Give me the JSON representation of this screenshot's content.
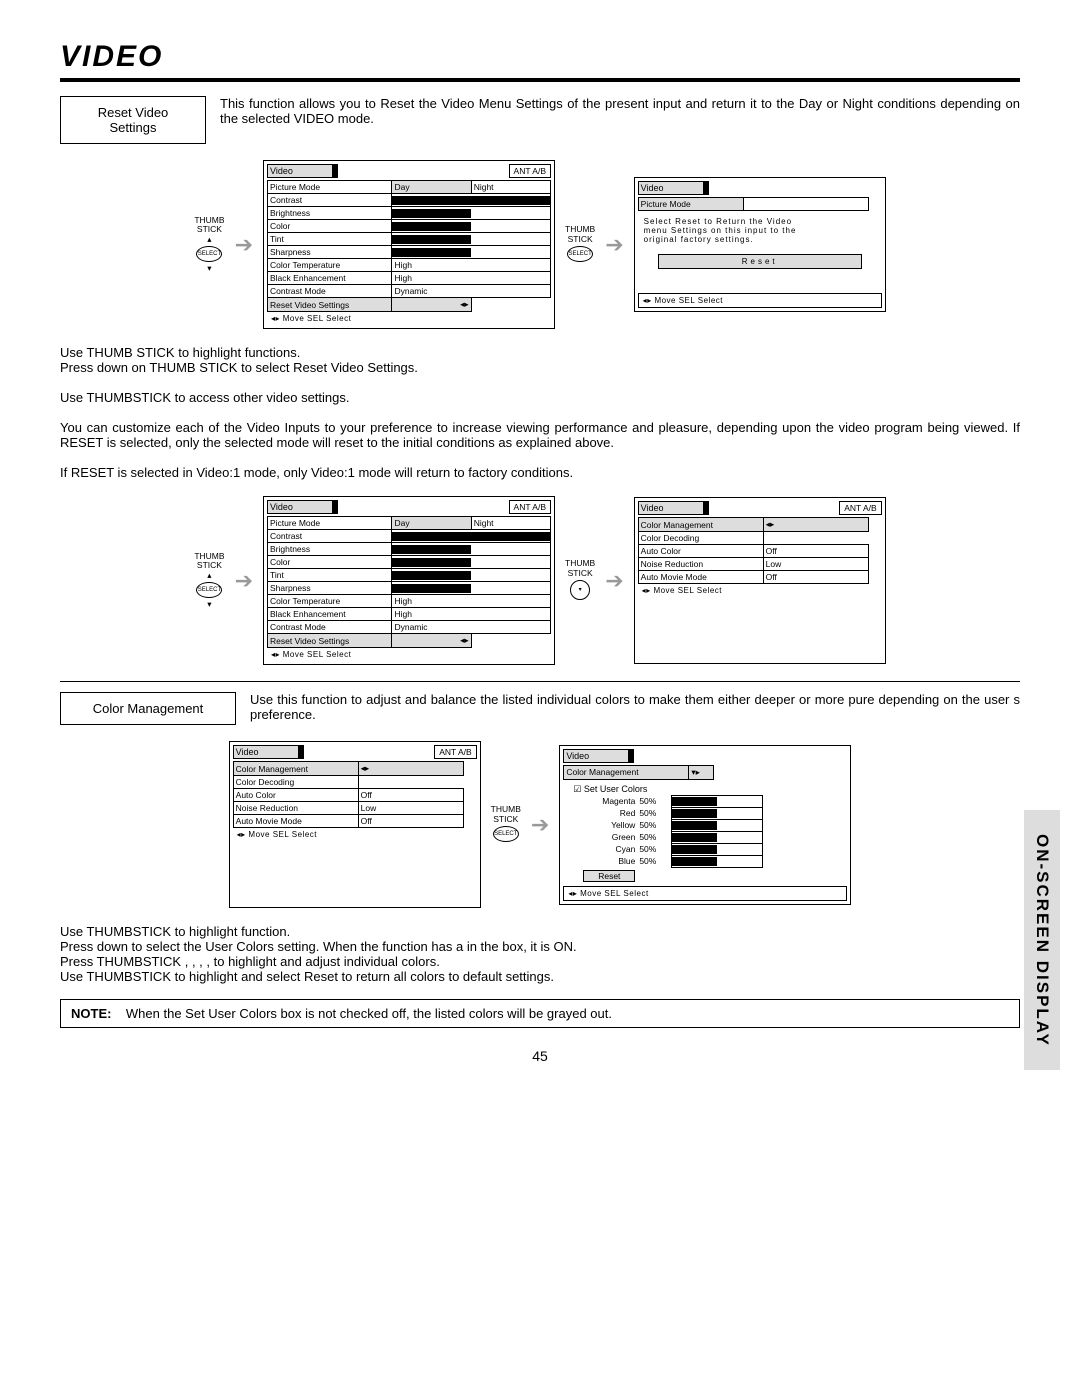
{
  "title": "VIDEO",
  "sideTab": "ON-SCREEN DISPLAY",
  "pageNumber": "45",
  "sections": {
    "resetVideo": {
      "label": "Reset Video Settings",
      "desc": "This function allows you to Reset the Video Menu Settings of the present input and return it to the Day or Night conditions depending on the selected VIDEO mode."
    },
    "instr1a": "Use THUMB STICK to highlight functions.",
    "instr1b": "Press down on THUMB STICK to select Reset Video Settings.",
    "instr2": "Use THUMBSTICK     to access other video settings.",
    "instr3": "You can customize each of the Video Inputs to your preference to increase viewing performance and pleasure, depending upon the video program being viewed. If RESET is selected, only the selected mode will reset to the initial conditions as explained above.",
    "instr4": "If RESET is selected in Video:1 mode, only Video:1 mode will return to factory conditions.",
    "colorMgmt": {
      "label": "Color Management",
      "desc": "Use this function to adjust and balance the listed individual colors to make them either deeper or more pure depending on the user s preference."
    },
    "instr5a": "Use THUMBSTICK to highlight function.",
    "instr5b": "Press down to select the User Colors setting.  When the function has a      in the box, it is ON.",
    "instr5c": "Press THUMBSTICK    ,    ,    ,    , to highlight and adjust individual colors.",
    "instr5d": "Use THUMBSTICK to highlight and select  Reset  to return all colors to default settings.",
    "noteLabel": "NOTE:",
    "noteText": "When the Set User Colors box is not checked off, the listed colors will be grayed out."
  },
  "thumb": {
    "label": "THUMB",
    "label2": "STICK",
    "sel": "SELECT"
  },
  "osd": {
    "videoMenu": {
      "title": "Video",
      "ant": "ANT A/B",
      "rows": [
        {
          "k": "Picture Mode",
          "v": "Day",
          "v2": "Night",
          "type": "split"
        },
        {
          "k": "Contrast",
          "v": "100%",
          "p": 100
        },
        {
          "k": "Brightness",
          "v": "50%",
          "p": 50
        },
        {
          "k": "Color",
          "v": "50%",
          "p": 50
        },
        {
          "k": "Tint",
          "v": "",
          "p": 50
        },
        {
          "k": "Sharpness",
          "v": "50%",
          "p": 50
        },
        {
          "k": "Color Temperature",
          "v": "High"
        },
        {
          "k": "Black Enhancement",
          "v": "High"
        },
        {
          "k": "Contrast Mode",
          "v": "Dynamic"
        },
        {
          "k": "Reset Video Settings",
          "v": "",
          "arrow": true
        }
      ],
      "foot": "Move   SEL  Select"
    },
    "resetDialog": {
      "title": "Video",
      "sub": "Picture Mode",
      "msg1": "Select  Reset  to Return the Video",
      "msg2": "menu Settings on this input to the",
      "msg3": "original factory settings.",
      "btn": "Reset",
      "foot": "Move            SEL   Select"
    },
    "colorMenu": {
      "title": "Video",
      "ant": "ANT A/B",
      "rows": [
        {
          "k": "Color Management",
          "arrow": true,
          "hi": true
        },
        {
          "k": "Color Decoding"
        },
        {
          "k": "Auto Color",
          "v": "Off"
        },
        {
          "k": "Noise Reduction",
          "v": "Low"
        },
        {
          "k": "Auto Movie Mode",
          "v": "Off"
        }
      ],
      "foot": "Move   SEL  Select"
    },
    "userColors": {
      "title": "Video",
      "sub": "Color Management",
      "setUser": "Set User Colors",
      "colors": [
        {
          "k": "Magenta",
          "v": "50%"
        },
        {
          "k": "Red",
          "v": "50%"
        },
        {
          "k": "Yellow",
          "v": "50%"
        },
        {
          "k": "Green",
          "v": "50%"
        },
        {
          "k": "Cyan",
          "v": "50%"
        },
        {
          "k": "Blue",
          "v": "50%"
        }
      ],
      "reset": "Reset",
      "foot": "Move            SEL   Select"
    }
  }
}
